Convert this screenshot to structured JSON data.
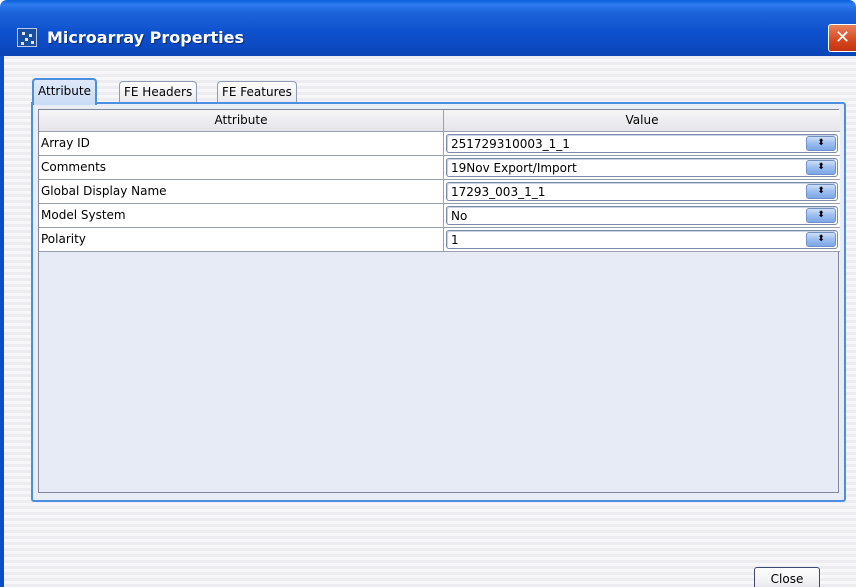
{
  "window": {
    "title": "Microarray Properties",
    "close_glyph": "✕"
  },
  "tabs": [
    {
      "label": "Attribute",
      "active": true
    },
    {
      "label": "FE Headers",
      "active": false
    },
    {
      "label": "FE Features",
      "active": false
    }
  ],
  "table": {
    "columns": [
      "Attribute",
      "Value"
    ],
    "rows": [
      {
        "attribute": "Array ID",
        "value": "251729310003_1_1"
      },
      {
        "attribute": "Comments",
        "value": "19Nov Export/Import"
      },
      {
        "attribute": "Global Display Name",
        "value": "17293_003_1_1"
      },
      {
        "attribute": "Model System",
        "value": "No"
      },
      {
        "attribute": "Polarity",
        "value": "1"
      }
    ],
    "dropdown_glyph": "⬍"
  },
  "footer": {
    "close_label": "Close"
  },
  "colors": {
    "title_bar": "#0b4fc7",
    "tab_accent": "#4c8fe0",
    "close_red": "#d7471f"
  },
  "icons": {
    "app": "microarray-icon",
    "close": "close-icon",
    "dropdown": "up-down-arrow-icon"
  }
}
